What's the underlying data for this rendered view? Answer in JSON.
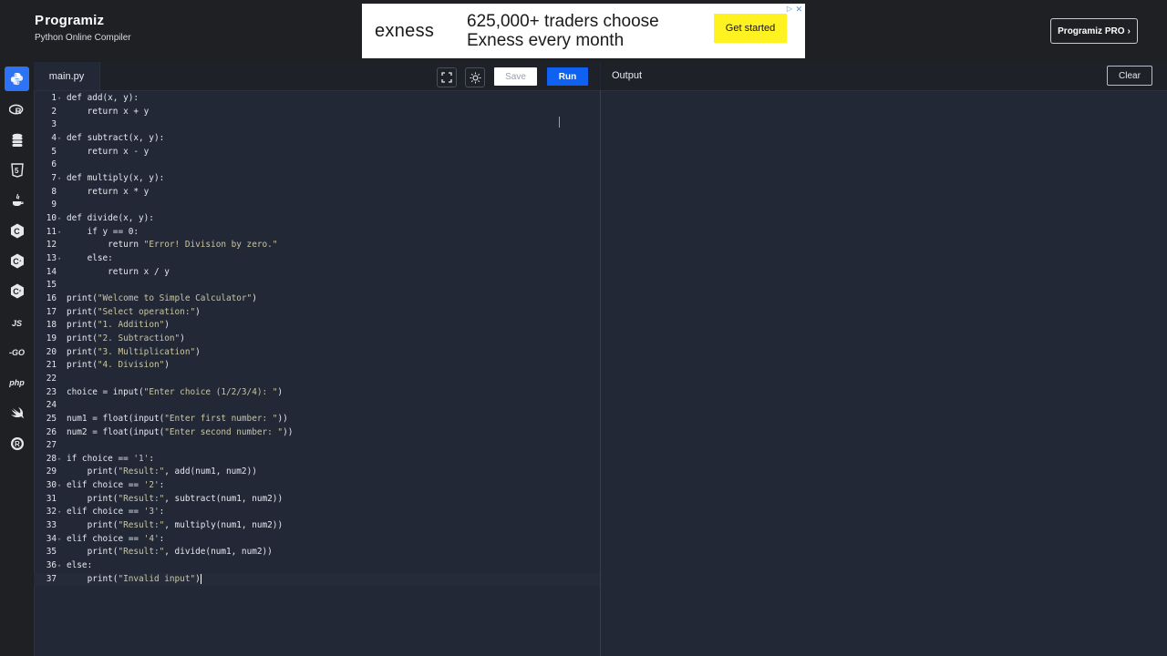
{
  "brand": {
    "logo_text": "rogramiz",
    "logo_initial": "P",
    "subtitle": "Python Online Compiler"
  },
  "ad": {
    "logo": "exness",
    "headline_line1": "625,000+ traders choose",
    "headline_line2": "Exness every month",
    "cta": "Get started",
    "close_icon": "close-icon"
  },
  "header": {
    "pro_button": "Programiz PRO",
    "pro_chevron": "›"
  },
  "sidebar": {
    "items": [
      {
        "name": "python",
        "active": true
      },
      {
        "name": "r"
      },
      {
        "name": "sql"
      },
      {
        "name": "html"
      },
      {
        "name": "java"
      },
      {
        "name": "c"
      },
      {
        "name": "cpp"
      },
      {
        "name": "csharp"
      },
      {
        "name": "js",
        "label": "JS"
      },
      {
        "name": "go",
        "label": "-GO"
      },
      {
        "name": "php",
        "label": "php"
      },
      {
        "name": "swift"
      },
      {
        "name": "rust"
      }
    ]
  },
  "editor": {
    "tab": "main.py",
    "save_label": "Save",
    "run_label": "Run",
    "lines": [
      {
        "n": "1",
        "fold": true,
        "code": "def add(x, y):"
      },
      {
        "n": "2",
        "code": "    return x + y"
      },
      {
        "n": "3",
        "code": ""
      },
      {
        "n": "4",
        "fold": true,
        "code": "def subtract(x, y):"
      },
      {
        "n": "5",
        "code": "    return x - y"
      },
      {
        "n": "6",
        "code": ""
      },
      {
        "n": "7",
        "fold": true,
        "code": "def multiply(x, y):"
      },
      {
        "n": "8",
        "code": "    return x * y"
      },
      {
        "n": "9",
        "code": ""
      },
      {
        "n": "10",
        "fold": true,
        "code": "def divide(x, y):"
      },
      {
        "n": "11",
        "fold": true,
        "code": "    if y == 0:"
      },
      {
        "n": "12",
        "code": "        return \"Error! Division by zero.\""
      },
      {
        "n": "13",
        "fold": true,
        "code": "    else:"
      },
      {
        "n": "14",
        "code": "        return x / y"
      },
      {
        "n": "15",
        "code": ""
      },
      {
        "n": "16",
        "code": "print(\"Welcome to Simple Calculator\")"
      },
      {
        "n": "17",
        "code": "print(\"Select operation:\")"
      },
      {
        "n": "18",
        "code": "print(\"1. Addition\")"
      },
      {
        "n": "19",
        "code": "print(\"2. Subtraction\")"
      },
      {
        "n": "20",
        "code": "print(\"3. Multiplication\")"
      },
      {
        "n": "21",
        "code": "print(\"4. Division\")"
      },
      {
        "n": "22",
        "code": ""
      },
      {
        "n": "23",
        "code": "choice = input(\"Enter choice (1/2/3/4): \")"
      },
      {
        "n": "24",
        "code": ""
      },
      {
        "n": "25",
        "code": "num1 = float(input(\"Enter first number: \"))"
      },
      {
        "n": "26",
        "code": "num2 = float(input(\"Enter second number: \"))"
      },
      {
        "n": "27",
        "code": ""
      },
      {
        "n": "28",
        "fold": true,
        "code": "if choice == '1':"
      },
      {
        "n": "29",
        "code": "    print(\"Result:\", add(num1, num2))"
      },
      {
        "n": "30",
        "fold": true,
        "code": "elif choice == '2':"
      },
      {
        "n": "31",
        "code": "    print(\"Result:\", subtract(num1, num2))"
      },
      {
        "n": "32",
        "fold": true,
        "code": "elif choice == '3':"
      },
      {
        "n": "33",
        "code": "    print(\"Result:\", multiply(num1, num2))"
      },
      {
        "n": "34",
        "fold": true,
        "code": "elif choice == '4':"
      },
      {
        "n": "35",
        "code": "    print(\"Result:\", divide(num1, num2))"
      },
      {
        "n": "36",
        "fold": true,
        "code": "else:"
      },
      {
        "n": "37",
        "code": "    print(\"Invalid input\")",
        "current": true
      }
    ]
  },
  "output": {
    "title": "Output",
    "clear_label": "Clear",
    "content": ""
  },
  "colors": {
    "accent": "#0f61f2",
    "editor_bg": "#232837",
    "topbar_bg": "#1f2023",
    "ad_cta": "#fff221"
  }
}
